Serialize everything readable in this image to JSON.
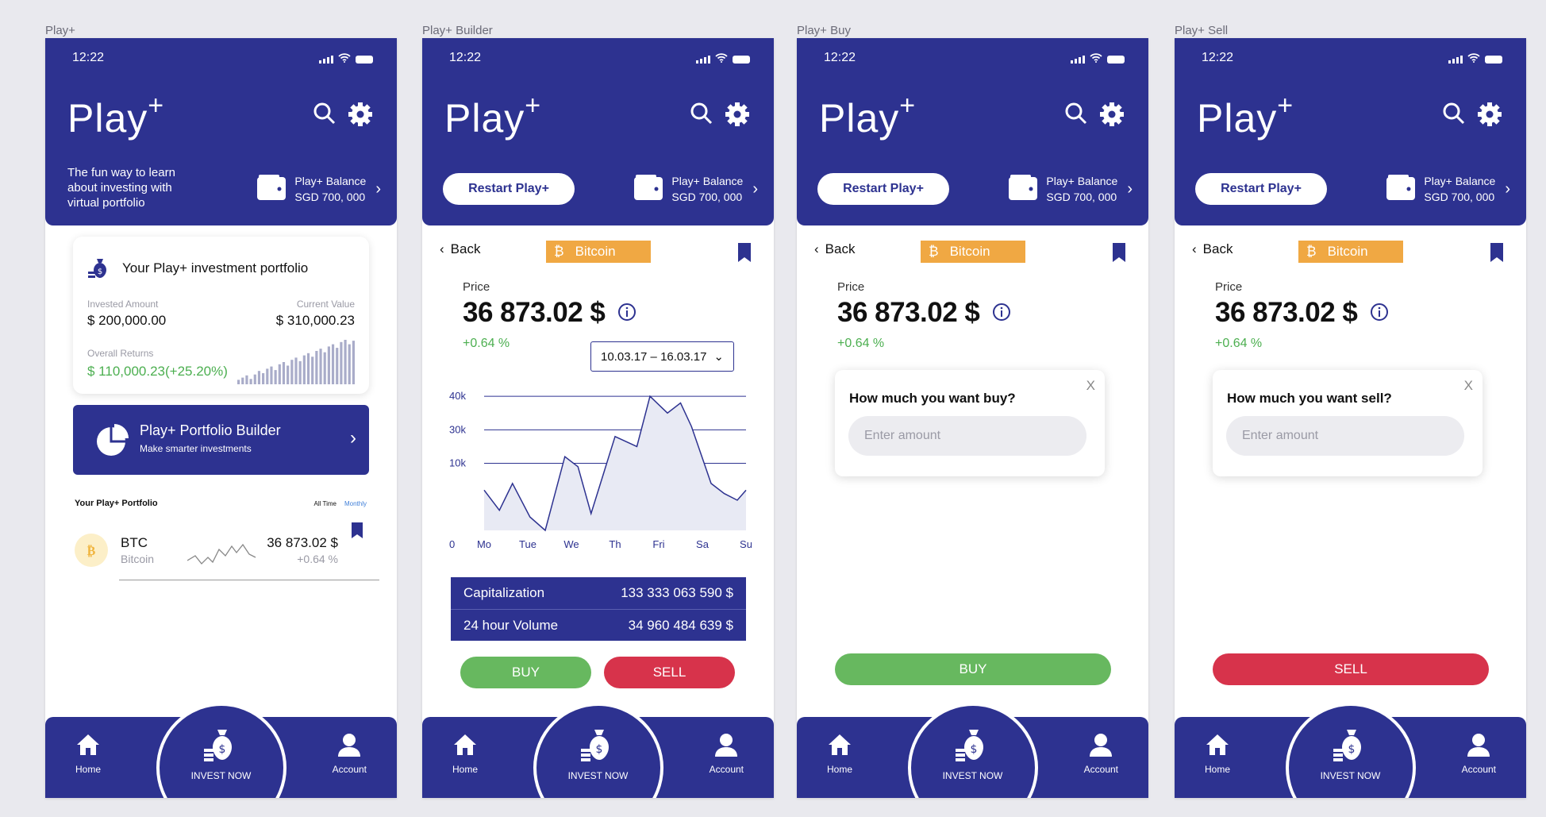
{
  "screens": {
    "home": {
      "artboard_label": "Play+",
      "status_time": "12:22",
      "brand": "Play",
      "brand_sup": "+",
      "tagline": "The fun way to learn about investing with virtual portfolio",
      "balance_label": "Play+ Balance",
      "balance_value": "SGD 700, 000",
      "portfolio_card": {
        "title": "Your Play+ investment portfolio",
        "invested_label": "Invested Amount",
        "invested_value": "$ 200,000.00",
        "current_label": "Current Value",
        "current_value": "$ 310,000.23",
        "returns_label": "Overall Returns",
        "returns_value": "$ 110,000.23(+25.20%)",
        "mini_bars": [
          0.1,
          0.15,
          0.2,
          0.12,
          0.22,
          0.3,
          0.25,
          0.35,
          0.4,
          0.32,
          0.45,
          0.5,
          0.42,
          0.55,
          0.6,
          0.52,
          0.65,
          0.7,
          0.62,
          0.75,
          0.8,
          0.72,
          0.85,
          0.9,
          0.82,
          0.95,
          1.0,
          0.9,
          0.98
        ]
      },
      "builder": {
        "title": "Play+ Portfolio Builder",
        "subtitle": "Make smarter investments"
      },
      "portfolio_list": {
        "title": "Your Play+ Portfolio",
        "tabs": [
          "All Time",
          "Monthly"
        ],
        "item": {
          "symbol": "BTC",
          "name": "Bitcoin",
          "price": "36 873.02 $",
          "change": "+0.64 %"
        }
      }
    },
    "builder": {
      "artboard_label": "Play+ Builder",
      "date_range": "10.03.17 – 16.03.17",
      "stats": [
        {
          "label": "Capitalization",
          "value": "133 333 063 590 $"
        },
        {
          "label": "24 hour Volume",
          "value": "34 960 484 639 $"
        }
      ],
      "buy_label": "BUY",
      "sell_label": "SELL"
    },
    "buy": {
      "artboard_label": "Play+ Buy",
      "question": "How much you want buy?",
      "button": "BUY"
    },
    "sell": {
      "artboard_label": "Play+ Sell",
      "question": "How much you want sell?",
      "button": "SELL"
    }
  },
  "common": {
    "status_time": "12:22",
    "brand": "Play",
    "brand_sup": "+",
    "restart_label": "Restart Play+",
    "balance_label": "Play+ Balance",
    "balance_value": "SGD 700, 000",
    "back_label": "Back",
    "coin_label": "Bitcoin",
    "price_label": "Price",
    "price_value": "36 873.02 $",
    "change_value": "+0.64 %",
    "modal_close": "X",
    "amount_placeholder": "Enter amount",
    "nav": {
      "home": "Home",
      "invest": "INVEST NOW",
      "account": "Account"
    }
  },
  "colors": {
    "primary": "#2d3290",
    "accent": "#f0a843",
    "buy": "#67b85f",
    "sell": "#d7334b",
    "positive": "#4caf50"
  },
  "chart_data": {
    "type": "area",
    "title": "",
    "xlabel": "",
    "ylabel": "",
    "categories": [
      "Mo",
      "Tue",
      "We",
      "Th",
      "Fri",
      "Sa",
      "Su"
    ],
    "y_ticks": [
      "40k",
      "30k",
      "10k",
      "0"
    ],
    "series": [
      {
        "values": [
          12,
          6,
          14,
          4,
          0,
          22,
          19,
          5,
          28,
          25,
          40,
          35,
          38,
          31,
          14,
          11,
          9,
          12
        ]
      }
    ],
    "x_positions": [
      0,
      0.35,
      0.65,
      1.05,
      1.4,
      1.85,
      2.15,
      2.45,
      3.0,
      3.5,
      3.8,
      4.2,
      4.5,
      4.75,
      5.2,
      5.5,
      5.8,
      6.0
    ],
    "ylim": [
      0,
      45
    ],
    "grid": true
  }
}
